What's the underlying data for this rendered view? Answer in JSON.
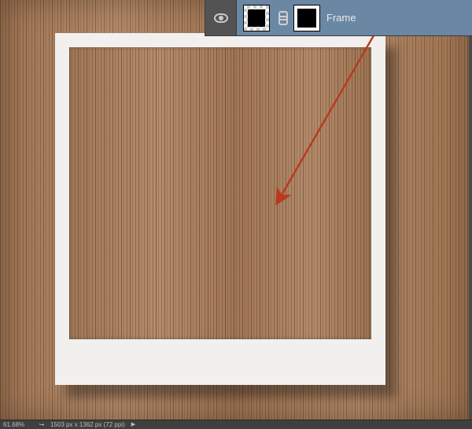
{
  "layer": {
    "name": "Frame",
    "visibility_icon": "eye-icon",
    "thumb_icon": "black-square",
    "mask_icon": "black-square",
    "link_icon": "chain-icon"
  },
  "status_bar": {
    "zoom": "61.68%",
    "share_icon": "↪",
    "doc_info": "1503 px x 1362 px (72 ppi)",
    "disclosure": "▶"
  },
  "colors": {
    "layer_select": "#6a87a3",
    "panel": "#535353",
    "arrow": "#b83a1f"
  }
}
